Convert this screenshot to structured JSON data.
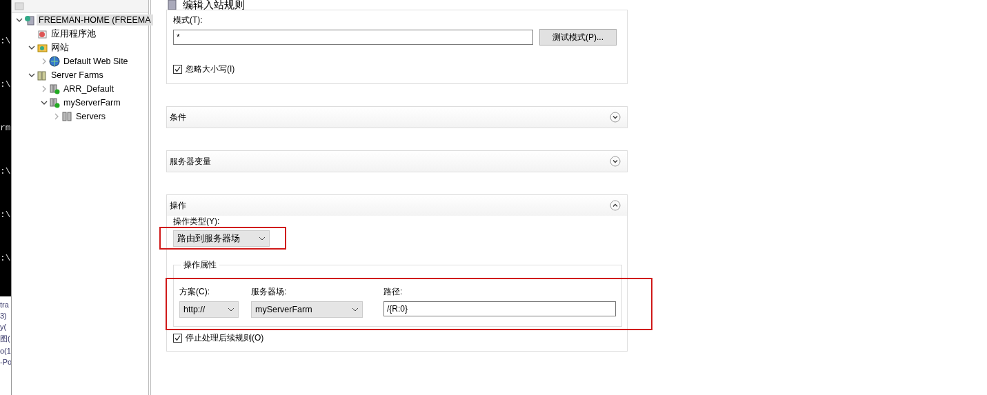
{
  "console": {
    "lines": [
      ":\\",
      ":\\",
      "rm",
      ":\\",
      ":\\",
      ":\\"
    ],
    "links": [
      "tra",
      "3)",
      "y(",
      "图(",
      "o(1",
      "-Po"
    ]
  },
  "tree": [
    {
      "label": "FREEMAN-HOME (FREEMA",
      "kind": "server",
      "expanded": true,
      "selected": true,
      "children": [
        {
          "label": "应用程序池",
          "kind": "pool",
          "selected": false
        },
        {
          "label": "网站",
          "kind": "sites",
          "expanded": true,
          "selected": false,
          "children": [
            {
              "label": "Default Web Site",
              "kind": "globe",
              "expanded": false,
              "selected": false
            }
          ]
        },
        {
          "label": "Server Farms",
          "kind": "farms",
          "expanded": true,
          "selected": false,
          "children": [
            {
              "label": "ARR_Default",
              "kind": "farm",
              "expanded": false,
              "selected": false
            },
            {
              "label": "myServerFarm",
              "kind": "farm",
              "expanded": true,
              "selected": false,
              "children": [
                {
                  "label": "Servers",
                  "kind": "servers",
                  "expanded": false,
                  "selected": false
                }
              ]
            }
          ]
        }
      ]
    }
  ],
  "page_title": "编辑入站规则",
  "match": {
    "pattern_label": "模式(T):",
    "pattern_value": "*",
    "test_button": "测试模式(P)...",
    "ignore_case": {
      "label": "忽略大小写(I)",
      "checked": true
    }
  },
  "sections": [
    {
      "title": "条件",
      "expanded": false
    },
    {
      "title": "服务器变量",
      "expanded": false
    },
    {
      "title": "操作",
      "expanded": true
    }
  ],
  "action": {
    "type_label": "操作类型(Y):",
    "type_value": "路由到服务器场",
    "group_title": "操作属性",
    "scheme_label": "方案(C):",
    "scheme_value": "http://",
    "farm_label": "服务器场:",
    "farm_value": "myServerFarm",
    "path_label": "路径:",
    "path_value": "/{R:0}",
    "stop": {
      "label": "停止处理后续规则(O)",
      "checked": true
    }
  }
}
